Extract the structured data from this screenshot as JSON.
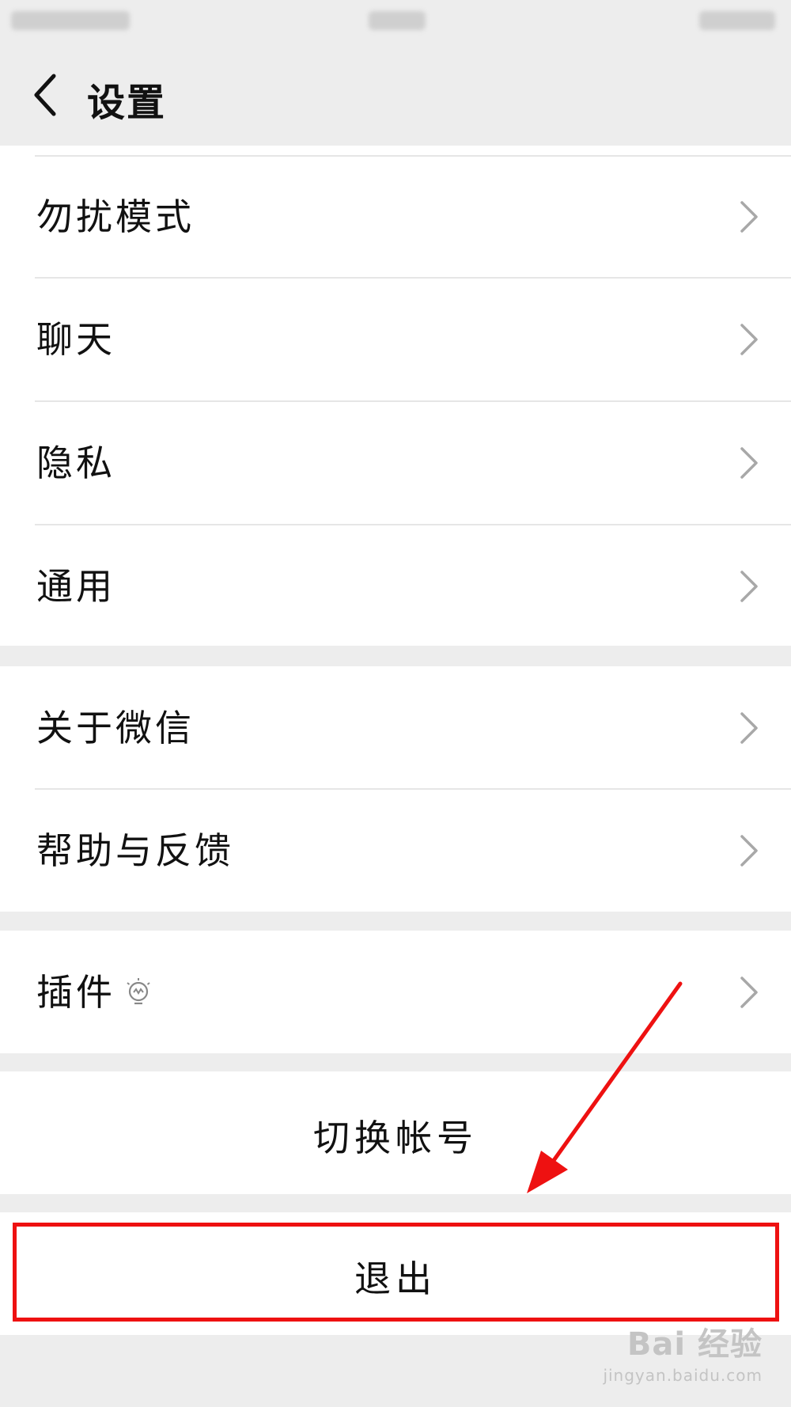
{
  "header": {
    "title": "设置"
  },
  "settings_group_1": {
    "items": [
      {
        "label": "勿扰模式"
      },
      {
        "label": "聊天"
      },
      {
        "label": "隐私"
      },
      {
        "label": "通用"
      }
    ]
  },
  "settings_group_2": {
    "items": [
      {
        "label": "关于微信"
      },
      {
        "label": "帮助与反馈"
      }
    ]
  },
  "settings_group_3": {
    "items": [
      {
        "label": "插件",
        "icon": "bulb-icon"
      }
    ]
  },
  "actions": {
    "switch_account_label": "切换帐号",
    "logout_label": "退出"
  },
  "annotation": {
    "highlight_color": "#ee1111"
  },
  "watermark": {
    "logo_text": "Bai 经验",
    "url": "jingyan.baidu.com"
  }
}
